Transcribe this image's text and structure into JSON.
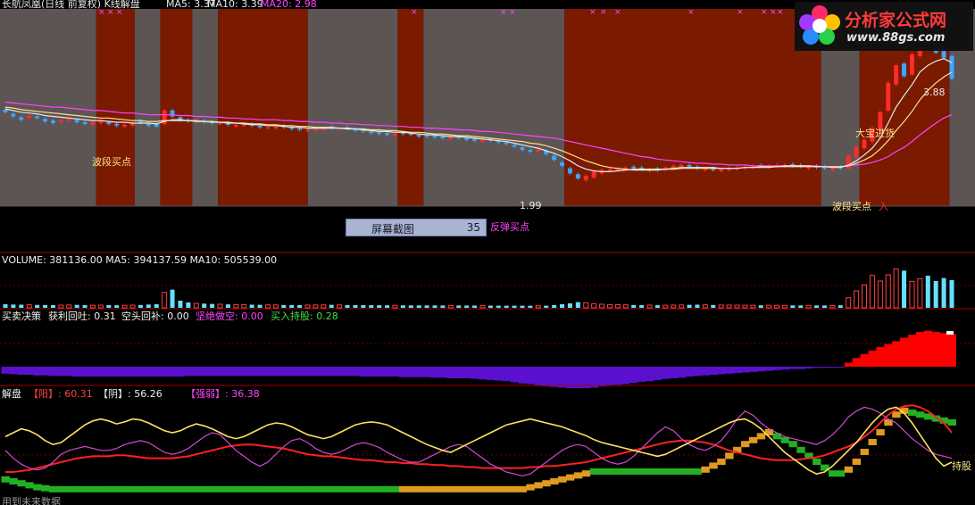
{
  "header": {
    "stock_title": "长航凤凰(日线 前复权) K线解盘",
    "ma5": "MA5: 3.37",
    "ma10": "MA10: 3.39",
    "ma20": "MA20: 2.98"
  },
  "logo": {
    "name": "分析家公式网",
    "url": "www.88gs.com"
  },
  "tooltip": {
    "label": "屏幕截图",
    "value": "35"
  },
  "annotations": {
    "wave_buy_1": "波段买点",
    "wave_buy_2": "波段买点",
    "rebound_buy": "反弹买点",
    "big_buy": "大宝进货",
    "buy_in": "入",
    "low_price": "1.99",
    "high_price": "3.88",
    "hold": "持股"
  },
  "panels": {
    "volume": "VOLUME: 381136.00  MA5: 394137.59  MA10: 505539.00",
    "decision_title": "买卖决策",
    "decision_profit": "获利回吐: 0.31",
    "decision_cover": "空头回补: 0.00",
    "decision_short": "坚绝做空: 0.00",
    "decision_hold": "买入持股: 0.28",
    "jiepan_title": "解盘",
    "jiepan_yang": "【阳】: 60.31",
    "jiepan_yin": "【阴】: 56.26",
    "jiepan_strength": "【强弱】: 36.38",
    "bottom_note": "用到未来数据"
  },
  "chart_data": {
    "type": "candlestick",
    "title": "长航凤凰(日线 前复权) K线解盘",
    "ylim": [
      1.8,
      4.1
    ],
    "price_low": 1.99,
    "price_high": 3.88,
    "candles_close": [
      2.91,
      2.86,
      2.82,
      2.87,
      2.84,
      2.8,
      2.78,
      2.81,
      2.83,
      2.79,
      2.77,
      2.79,
      2.8,
      2.77,
      2.75,
      2.76,
      2.78,
      2.78,
      2.75,
      2.74,
      2.93,
      2.86,
      2.81,
      2.8,
      2.8,
      2.79,
      2.78,
      2.78,
      2.76,
      2.76,
      2.77,
      2.75,
      2.73,
      2.73,
      2.74,
      2.73,
      2.71,
      2.7,
      2.7,
      2.71,
      2.72,
      2.72,
      2.72,
      2.71,
      2.69,
      2.68,
      2.66,
      2.65,
      2.64,
      2.65,
      2.65,
      2.64,
      2.62,
      2.62,
      2.61,
      2.6,
      2.61,
      2.6,
      2.58,
      2.57,
      2.58,
      2.57,
      2.55,
      2.53,
      2.5,
      2.46,
      2.44,
      2.47,
      2.41,
      2.34,
      2.27,
      2.18,
      2.12,
      2.15,
      2.2,
      2.22,
      2.23,
      2.24,
      2.25,
      2.24,
      2.23,
      2.23,
      2.22,
      2.25,
      2.27,
      2.28,
      2.26,
      2.24,
      2.24,
      2.22,
      2.23,
      2.24,
      2.25,
      2.26,
      2.27,
      2.26,
      2.27,
      2.28,
      2.28,
      2.27,
      2.26,
      2.26,
      2.25,
      2.24,
      2.24,
      2.24,
      2.39,
      2.5,
      2.58,
      2.72,
      2.91,
      3.26,
      3.47,
      3.34,
      3.6,
      3.86,
      3.7,
      3.62,
      3.56,
      3.31
    ],
    "candles_open": [
      2.94,
      2.89,
      2.85,
      2.84,
      2.86,
      2.83,
      2.81,
      2.79,
      2.81,
      2.82,
      2.79,
      2.76,
      2.78,
      2.79,
      2.77,
      2.74,
      2.75,
      2.81,
      2.78,
      2.77,
      2.77,
      2.93,
      2.85,
      2.82,
      2.79,
      2.81,
      2.8,
      2.77,
      2.78,
      2.74,
      2.75,
      2.77,
      2.75,
      2.72,
      2.72,
      2.75,
      2.74,
      2.72,
      2.69,
      2.69,
      2.7,
      2.74,
      2.71,
      2.73,
      2.71,
      2.7,
      2.68,
      2.67,
      2.66,
      2.63,
      2.67,
      2.66,
      2.64,
      2.63,
      2.63,
      2.62,
      2.59,
      2.62,
      2.6,
      2.59,
      2.56,
      2.59,
      2.57,
      2.55,
      2.52,
      2.49,
      2.46,
      2.44,
      2.45,
      2.39,
      2.31,
      2.24,
      2.17,
      2.1,
      2.13,
      2.18,
      2.21,
      2.22,
      2.23,
      2.26,
      2.25,
      2.21,
      2.24,
      2.22,
      2.24,
      2.26,
      2.28,
      2.26,
      2.22,
      2.24,
      2.21,
      2.22,
      2.23,
      2.24,
      2.25,
      2.28,
      2.25,
      2.26,
      2.26,
      2.29,
      2.28,
      2.24,
      2.27,
      2.26,
      2.22,
      2.26,
      2.24,
      2.37,
      2.48,
      2.56,
      2.7,
      2.93,
      3.24,
      3.49,
      3.36,
      3.58,
      3.88,
      3.68,
      3.64,
      3.58
    ],
    "ma_white": [
      2.95,
      2.93,
      2.91,
      2.9,
      2.89,
      2.87,
      2.86,
      2.85,
      2.84,
      2.83,
      2.82,
      2.81,
      2.81,
      2.8,
      2.79,
      2.79,
      2.78,
      2.78,
      2.78,
      2.77,
      2.8,
      2.82,
      2.82,
      2.81,
      2.8,
      2.8,
      2.79,
      2.79,
      2.78,
      2.78,
      2.77,
      2.76,
      2.76,
      2.75,
      2.75,
      2.74,
      2.73,
      2.73,
      2.72,
      2.72,
      2.72,
      2.72,
      2.72,
      2.71,
      2.71,
      2.7,
      2.69,
      2.68,
      2.68,
      2.67,
      2.67,
      2.66,
      2.65,
      2.64,
      2.64,
      2.63,
      2.62,
      2.62,
      2.61,
      2.6,
      2.59,
      2.58,
      2.57,
      2.56,
      2.54,
      2.52,
      2.5,
      2.48,
      2.45,
      2.42,
      2.38,
      2.33,
      2.27,
      2.23,
      2.21,
      2.2,
      2.2,
      2.21,
      2.22,
      2.23,
      2.23,
      2.23,
      2.23,
      2.23,
      2.24,
      2.25,
      2.25,
      2.25,
      2.25,
      2.25,
      2.24,
      2.24,
      2.24,
      2.25,
      2.25,
      2.26,
      2.26,
      2.26,
      2.27,
      2.27,
      2.27,
      2.27,
      2.26,
      2.26,
      2.25,
      2.25,
      2.28,
      2.33,
      2.4,
      2.48,
      2.6,
      2.78,
      2.97,
      3.11,
      3.24,
      3.39,
      3.47,
      3.52,
      3.55,
      3.5
    ],
    "ma_yellow": [
      2.97,
      2.96,
      2.94,
      2.93,
      2.92,
      2.91,
      2.9,
      2.89,
      2.88,
      2.87,
      2.86,
      2.85,
      2.84,
      2.84,
      2.83,
      2.82,
      2.81,
      2.81,
      2.8,
      2.8,
      2.81,
      2.81,
      2.81,
      2.81,
      2.81,
      2.8,
      2.8,
      2.79,
      2.79,
      2.78,
      2.78,
      2.77,
      2.77,
      2.76,
      2.76,
      2.75,
      2.75,
      2.74,
      2.74,
      2.73,
      2.73,
      2.73,
      2.72,
      2.72,
      2.71,
      2.71,
      2.7,
      2.7,
      2.69,
      2.69,
      2.68,
      2.67,
      2.67,
      2.66,
      2.65,
      2.65,
      2.64,
      2.63,
      2.63,
      2.62,
      2.61,
      2.6,
      2.59,
      2.58,
      2.57,
      2.56,
      2.54,
      2.53,
      2.51,
      2.48,
      2.45,
      2.41,
      2.37,
      2.33,
      2.3,
      2.27,
      2.25,
      2.24,
      2.23,
      2.22,
      2.22,
      2.22,
      2.22,
      2.23,
      2.23,
      2.24,
      2.24,
      2.24,
      2.24,
      2.24,
      2.24,
      2.24,
      2.24,
      2.25,
      2.25,
      2.25,
      2.25,
      2.26,
      2.26,
      2.26,
      2.26,
      2.26,
      2.26,
      2.26,
      2.26,
      2.26,
      2.27,
      2.3,
      2.34,
      2.39,
      2.47,
      2.57,
      2.69,
      2.8,
      2.92,
      3.06,
      3.17,
      3.26,
      3.33,
      3.39
    ],
    "ma_magenta": [
      3.03,
      3.02,
      3.01,
      3.0,
      2.99,
      2.98,
      2.97,
      2.97,
      2.96,
      2.95,
      2.94,
      2.93,
      2.93,
      2.92,
      2.91,
      2.9,
      2.9,
      2.89,
      2.88,
      2.88,
      2.88,
      2.88,
      2.87,
      2.87,
      2.86,
      2.86,
      2.85,
      2.85,
      2.84,
      2.84,
      2.83,
      2.83,
      2.82,
      2.82,
      2.82,
      2.81,
      2.81,
      2.8,
      2.8,
      2.79,
      2.79,
      2.78,
      2.78,
      2.77,
      2.77,
      2.76,
      2.76,
      2.75,
      2.75,
      2.74,
      2.74,
      2.73,
      2.73,
      2.72,
      2.72,
      2.71,
      2.71,
      2.7,
      2.7,
      2.69,
      2.68,
      2.68,
      2.67,
      2.66,
      2.65,
      2.64,
      2.63,
      2.62,
      2.61,
      2.6,
      2.58,
      2.56,
      2.54,
      2.52,
      2.5,
      2.48,
      2.46,
      2.44,
      2.42,
      2.4,
      2.38,
      2.37,
      2.35,
      2.34,
      2.33,
      2.32,
      2.31,
      2.3,
      2.3,
      2.29,
      2.29,
      2.28,
      2.28,
      2.28,
      2.27,
      2.27,
      2.27,
      2.27,
      2.27,
      2.27,
      2.27,
      2.27,
      2.27,
      2.26,
      2.26,
      2.26,
      2.27,
      2.28,
      2.29,
      2.31,
      2.34,
      2.38,
      2.44,
      2.49,
      2.56,
      2.64,
      2.71,
      2.78,
      2.84,
      2.88
    ],
    "volume": [
      120,
      110,
      105,
      100,
      98,
      95,
      92,
      90,
      95,
      98,
      90,
      85,
      88,
      92,
      86,
      84,
      90,
      95,
      110,
      120,
      520,
      610,
      240,
      180,
      150,
      140,
      130,
      120,
      115,
      110,
      108,
      105,
      100,
      98,
      96,
      94,
      92,
      90,
      92,
      95,
      98,
      100,
      96,
      94,
      92,
      90,
      88,
      86,
      85,
      84,
      83,
      82,
      81,
      80,
      80,
      79,
      78,
      78,
      77,
      76,
      75,
      74,
      73,
      72,
      72,
      71,
      70,
      70,
      72,
      90,
      120,
      150,
      190,
      170,
      140,
      120,
      110,
      105,
      100,
      95,
      92,
      90,
      88,
      87,
      90,
      95,
      100,
      105,
      100,
      96,
      92,
      90,
      88,
      86,
      85,
      84,
      84,
      83,
      82,
      82,
      81,
      80,
      80,
      79,
      78,
      85,
      340,
      570,
      770,
      1090,
      900,
      1110,
      1310,
      1250,
      890,
      980,
      1080,
      900,
      1000,
      930
    ],
    "decision": [
      -0.12,
      -0.13,
      -0.14,
      -0.14,
      -0.15,
      -0.15,
      -0.16,
      -0.16,
      -0.16,
      -0.17,
      -0.17,
      -0.17,
      -0.17,
      -0.17,
      -0.17,
      -0.17,
      -0.17,
      -0.17,
      -0.17,
      -0.17,
      -0.17,
      -0.17,
      -0.17,
      -0.16,
      -0.16,
      -0.16,
      -0.16,
      -0.16,
      -0.16,
      -0.16,
      -0.16,
      -0.16,
      -0.16,
      -0.16,
      -0.16,
      -0.16,
      -0.16,
      -0.16,
      -0.16,
      -0.16,
      -0.16,
      -0.16,
      -0.16,
      -0.16,
      -0.16,
      -0.17,
      -0.17,
      -0.17,
      -0.17,
      -0.17,
      -0.18,
      -0.18,
      -0.18,
      -0.18,
      -0.19,
      -0.19,
      -0.2,
      -0.2,
      -0.2,
      -0.21,
      -0.22,
      -0.23,
      -0.24,
      -0.25,
      -0.27,
      -0.29,
      -0.3,
      -0.32,
      -0.34,
      -0.35,
      -0.36,
      -0.37,
      -0.37,
      -0.37,
      -0.36,
      -0.34,
      -0.33,
      -0.31,
      -0.3,
      -0.28,
      -0.26,
      -0.25,
      -0.23,
      -0.21,
      -0.2,
      -0.19,
      -0.17,
      -0.16,
      -0.15,
      -0.14,
      -0.13,
      -0.12,
      -0.11,
      -0.1,
      -0.09,
      -0.08,
      -0.07,
      -0.06,
      -0.05,
      -0.04,
      -0.04,
      -0.03,
      -0.02,
      -0.02,
      -0.01,
      -0.01,
      0.07,
      0.15,
      0.22,
      0.28,
      0.34,
      0.39,
      0.44,
      0.5,
      0.55,
      0.6,
      0.62,
      0.6,
      0.58,
      0.56
    ],
    "jiepan_yellow": [
      66,
      70,
      74,
      72,
      68,
      62,
      58,
      60,
      66,
      72,
      78,
      82,
      84,
      82,
      79,
      81,
      84,
      83,
      80,
      76,
      72,
      70,
      72,
      76,
      79,
      77,
      74,
      70,
      66,
      64,
      66,
      70,
      74,
      78,
      80,
      79,
      76,
      72,
      68,
      66,
      64,
      66,
      70,
      74,
      78,
      80,
      81,
      80,
      78,
      74,
      70,
      66,
      62,
      58,
      55,
      52,
      50,
      54,
      58,
      62,
      66,
      70,
      74,
      78,
      80,
      82,
      84,
      82,
      80,
      78,
      76,
      73,
      70,
      67,
      63,
      60,
      58,
      56,
      54,
      52,
      50,
      48,
      46,
      48,
      52,
      56,
      60,
      64,
      68,
      72,
      76,
      80,
      83,
      84,
      80,
      74,
      66,
      58,
      50,
      44,
      38,
      32,
      28,
      30,
      36,
      44,
      52,
      60,
      70,
      80,
      88,
      94,
      96,
      90,
      80,
      68,
      56,
      44,
      36,
      40
    ],
    "jiepan_red": [
      30,
      30,
      31,
      32,
      34,
      36,
      38,
      40,
      42,
      44,
      45,
      46,
      46,
      46,
      47,
      47,
      46,
      45,
      44,
      44,
      44,
      44,
      45,
      46,
      48,
      50,
      52,
      54,
      56,
      57,
      58,
      58,
      57,
      56,
      55,
      54,
      52,
      50,
      48,
      47,
      46,
      46,
      45,
      44,
      43,
      42,
      42,
      41,
      40,
      40,
      39,
      39,
      38,
      38,
      37,
      37,
      36,
      36,
      35,
      35,
      34,
      34,
      34,
      34,
      34,
      34,
      35,
      35,
      36,
      36,
      37,
      38,
      39,
      40,
      42,
      44,
      46,
      48,
      50,
      52,
      54,
      56,
      58,
      60,
      61,
      62,
      62,
      61,
      60,
      58,
      55,
      52,
      50,
      48,
      46,
      44,
      43,
      42,
      42,
      42,
      43,
      44,
      45,
      47,
      50,
      53,
      56,
      60,
      66,
      72,
      80,
      88,
      94,
      97,
      98,
      96,
      92,
      86,
      80,
      70
    ],
    "jiepan_magenta": [
      52,
      44,
      38,
      34,
      32,
      34,
      40,
      48,
      52,
      54,
      56,
      54,
      52,
      52,
      54,
      58,
      60,
      62,
      60,
      55,
      50,
      48,
      50,
      54,
      60,
      66,
      70,
      68,
      60,
      52,
      46,
      40,
      36,
      40,
      48,
      56,
      62,
      64,
      60,
      54,
      50,
      48,
      50,
      54,
      58,
      60,
      58,
      55,
      50,
      46,
      42,
      40,
      40,
      44,
      48,
      52,
      56,
      58,
      56,
      50,
      44,
      38,
      34,
      30,
      28,
      26,
      28,
      34,
      40,
      46,
      52,
      56,
      58,
      56,
      50,
      44,
      40,
      38,
      40,
      46,
      54,
      62,
      70,
      76,
      72,
      64,
      58,
      54,
      52,
      56,
      62,
      72,
      84,
      92,
      88,
      80,
      74,
      70,
      66,
      64,
      62,
      60,
      58,
      62,
      68,
      76,
      86,
      92,
      96,
      94,
      90,
      84,
      80,
      72,
      64,
      58,
      52,
      48,
      46,
      44
    ],
    "jiepan_steps": [
      22,
      20,
      18,
      16,
      14,
      13,
      12,
      12,
      12,
      12,
      12,
      12,
      12,
      12,
      12,
      12,
      12,
      12,
      12,
      12,
      12,
      12,
      12,
      12,
      12,
      12,
      12,
      12,
      12,
      12,
      12,
      12,
      12,
      12,
      12,
      12,
      12,
      12,
      12,
      12,
      12,
      12,
      12,
      12,
      12,
      12,
      12,
      12,
      12,
      12,
      12,
      12,
      12,
      12,
      12,
      12,
      12,
      12,
      12,
      12,
      12,
      12,
      12,
      12,
      12,
      12,
      14,
      16,
      18,
      20,
      22,
      24,
      26,
      28,
      30,
      30,
      30,
      30,
      30,
      30,
      30,
      30,
      30,
      30,
      30,
      30,
      30,
      30,
      32,
      36,
      40,
      46,
      52,
      58,
      62,
      66,
      70,
      66,
      62,
      58,
      52,
      46,
      40,
      34,
      28,
      28,
      32,
      40,
      50,
      60,
      70,
      80,
      88,
      92,
      90,
      88,
      86,
      84,
      82,
      80
    ],
    "jiepan_steps_color": [
      "g",
      "g",
      "g",
      "g",
      "g",
      "g",
      "g",
      "g",
      "g",
      "g",
      "g",
      "g",
      "g",
      "g",
      "g",
      "g",
      "g",
      "g",
      "g",
      "g",
      "g",
      "g",
      "g",
      "g",
      "g",
      "g",
      "g",
      "g",
      "g",
      "g",
      "g",
      "g",
      "g",
      "g",
      "g",
      "g",
      "g",
      "g",
      "g",
      "g",
      "g",
      "g",
      "g",
      "g",
      "g",
      "g",
      "g",
      "g",
      "g",
      "g",
      "o",
      "o",
      "o",
      "o",
      "o",
      "o",
      "o",
      "o",
      "o",
      "o",
      "o",
      "o",
      "o",
      "o",
      "o",
      "o",
      "o",
      "o",
      "o",
      "o",
      "o",
      "o",
      "o",
      "o",
      "g",
      "g",
      "g",
      "g",
      "g",
      "g",
      "g",
      "g",
      "g",
      "g",
      "g",
      "g",
      "g",
      "g",
      "o",
      "o",
      "o",
      "o",
      "o",
      "o",
      "o",
      "o",
      "o",
      "g",
      "g",
      "g",
      "g",
      "g",
      "g",
      "g",
      "g",
      "g",
      "o",
      "o",
      "o",
      "o",
      "o",
      "o",
      "o",
      "o",
      "g",
      "g",
      "g",
      "g",
      "g",
      "g"
    ],
    "bands": [
      [
        0,
        15,
        "gray"
      ],
      [
        15,
        21,
        "red"
      ],
      [
        21,
        25,
        "gray"
      ],
      [
        25,
        30,
        "red"
      ],
      [
        30,
        34,
        "gray"
      ],
      [
        34,
        48,
        "red"
      ],
      [
        48,
        62,
        "gray"
      ],
      [
        62,
        66,
        "red"
      ],
      [
        66,
        88,
        "gray"
      ],
      [
        88,
        128,
        "red"
      ],
      [
        128,
        134,
        "gray"
      ],
      [
        134,
        148,
        "red"
      ],
      [
        148,
        152,
        "gray"
      ]
    ],
    "colors": {
      "background": "#000000",
      "band_gray": "#5d5454",
      "band_red": "#7a1a00",
      "up_candle": "#ff2a2a",
      "down_candle": "#3aa8ff",
      "decision_neg": "#5a10cc",
      "decision_pos": "#ff0000",
      "volume_up": "#ff4040",
      "volume_down": "#66e0ff",
      "grid_red": "#a00000"
    }
  }
}
